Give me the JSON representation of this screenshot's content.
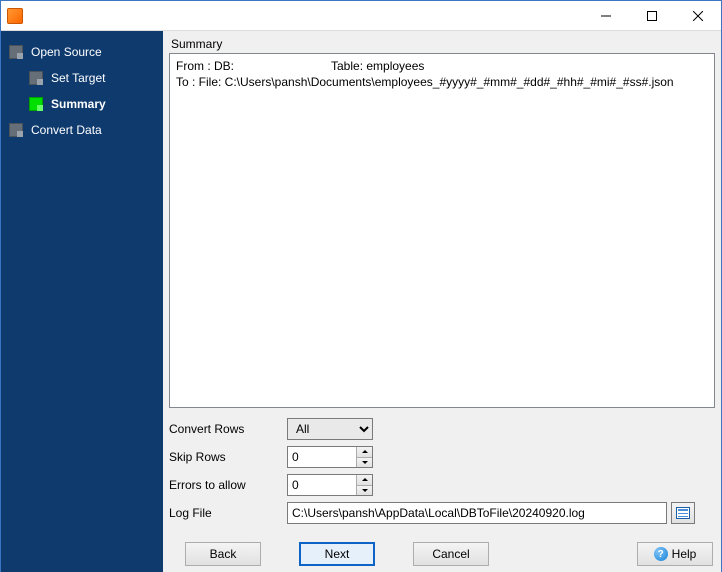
{
  "sidebar": {
    "items": [
      {
        "label": "Open Source"
      },
      {
        "label": "Set Target"
      },
      {
        "label": "Summary"
      },
      {
        "label": "Convert Data"
      }
    ]
  },
  "content": {
    "summary_label": "Summary",
    "from_prefix": "From : DB:",
    "from_table": "Table: employees",
    "to_line": "To : File: C:\\Users\\pansh\\Documents\\employees_#yyyy#_#mm#_#dd#_#hh#_#mi#_#ss#.json"
  },
  "params": {
    "convert_rows": {
      "label": "Convert Rows",
      "value": "All"
    },
    "skip_rows": {
      "label": "Skip Rows",
      "value": "0"
    },
    "errors_allow": {
      "label": "Errors to allow",
      "value": "0"
    },
    "log_file": {
      "label": "Log File",
      "value": "C:\\Users\\pansh\\AppData\\Local\\DBToFile\\20240920.log"
    }
  },
  "buttons": {
    "back": "Back",
    "next": "Next",
    "cancel": "Cancel",
    "help": "Help"
  }
}
